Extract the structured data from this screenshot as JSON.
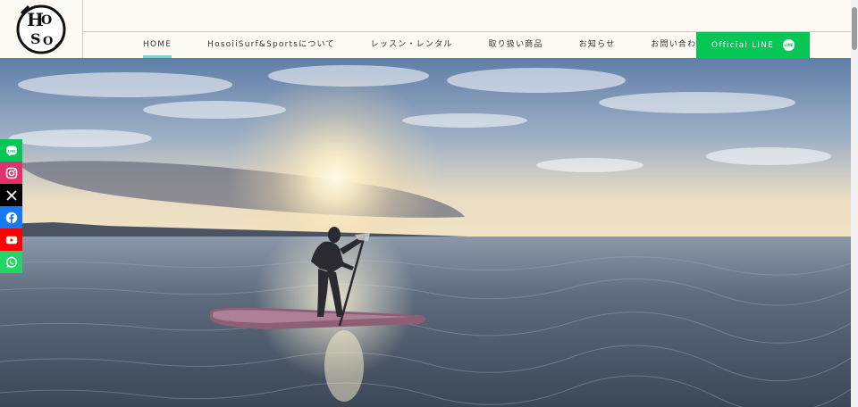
{
  "header": {
    "logo_text": "HOSOII",
    "nav": [
      {
        "label": "HOME",
        "active": true
      },
      {
        "label": "HosoiiSurf&Sportsについて",
        "active": false
      },
      {
        "label": "レッスン・レンタル",
        "active": false
      },
      {
        "label": "取り扱い商品",
        "active": false
      },
      {
        "label": "お知らせ",
        "active": false
      },
      {
        "label": "お問い合わせ",
        "active": false
      }
    ],
    "line_button": {
      "label": "Official LINE",
      "icon_text": "LINE",
      "color": "#06c755"
    }
  },
  "hero": {
    "description_icon": "paddleboard-sunset-photo"
  },
  "social": [
    {
      "name": "line-icon",
      "color": "#06c755"
    },
    {
      "name": "instagram-icon",
      "color": "#e1306c"
    },
    {
      "name": "x-icon",
      "color": "#000000"
    },
    {
      "name": "facebook-icon",
      "color": "#1877f2"
    },
    {
      "name": "youtube-icon",
      "color": "#ff0000"
    },
    {
      "name": "whatsapp-icon",
      "color": "#25d366"
    }
  ]
}
